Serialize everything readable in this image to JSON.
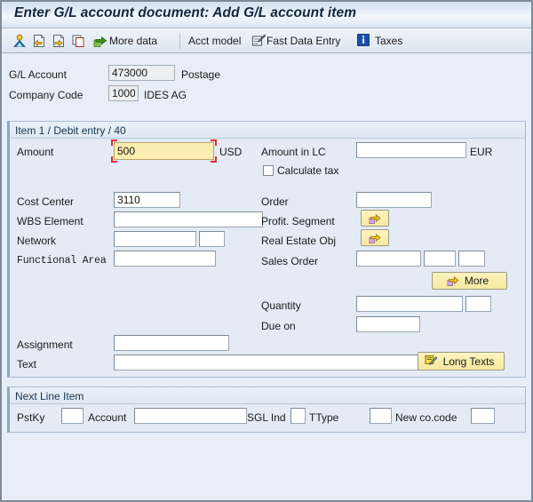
{
  "window": {
    "title": "Enter G/L account document: Add G/L account item"
  },
  "toolbar": {
    "items": [
      {
        "name": "person-icon",
        "label": "",
        "icon": "person-icon"
      },
      {
        "name": "prev-screen-icon",
        "label": "",
        "icon": "page-left-arrow-icon"
      },
      {
        "name": "next-screen-icon",
        "label": "",
        "icon": "page-right-arrow-icon"
      },
      {
        "name": "copy-icon",
        "label": "",
        "icon": "copy-icon"
      },
      {
        "name": "more-data-button",
        "label": "More data",
        "icon": "green-right-arrow-icon"
      },
      {
        "name": "acct-model-button",
        "label": "Acct model",
        "icon": "none"
      },
      {
        "name": "fast-data-entry-button",
        "label": "Fast Data Entry",
        "icon": "pencil-form-icon"
      },
      {
        "name": "taxes-button",
        "label": "Taxes",
        "icon": "info-icon"
      }
    ]
  },
  "header": {
    "gl_account": {
      "label": "G/L Account",
      "value": "473000",
      "text": "Postage"
    },
    "company_code": {
      "label": "Company Code",
      "value": "1000",
      "text": "IDES AG"
    }
  },
  "item_panel": {
    "title": "Item 1 / Debit entry / 40",
    "amount": {
      "label": "Amount",
      "value": "500",
      "currency": "USD"
    },
    "amount_lc": {
      "label": "Amount in LC",
      "value": "",
      "currency": "EUR"
    },
    "calculate_tax": {
      "label": "Calculate tax",
      "checked": false
    },
    "cost_center": {
      "label": "Cost Center",
      "value": "3110"
    },
    "wbs_element": {
      "label": "WBS Element",
      "value": ""
    },
    "network": {
      "label": "Network",
      "value": "",
      "value2": ""
    },
    "functional_area": {
      "label": "Functional Area",
      "value": ""
    },
    "order": {
      "label": "Order",
      "value": ""
    },
    "profit_segment": {
      "label": "Profit. Segment",
      "button": ""
    },
    "real_estate_obj": {
      "label": "Real Estate Obj",
      "button": ""
    },
    "sales_order": {
      "label": "Sales Order",
      "value": "",
      "value2": "",
      "value3": ""
    },
    "more_button": {
      "label": "More"
    },
    "quantity": {
      "label": "Quantity",
      "value": "",
      "unit": ""
    },
    "due_on": {
      "label": "Due on",
      "value": ""
    },
    "assignment": {
      "label": "Assignment",
      "value": ""
    },
    "text": {
      "label": "Text",
      "value": ""
    },
    "long_texts_button": {
      "label": "Long Texts"
    }
  },
  "next_line_item": {
    "title": "Next Line Item",
    "pstky": {
      "label": "PstKy",
      "value": ""
    },
    "account": {
      "label": "Account",
      "value": ""
    },
    "sgl_ind": {
      "label": "SGL Ind",
      "value": ""
    },
    "ttype": {
      "label": "TType",
      "value": ""
    },
    "new_cocode": {
      "label": "New co.code",
      "value": ""
    }
  },
  "colors": {
    "window_bg": "#e8eef7",
    "panel_bg": "#e4ebf5",
    "panel_border": "#a9bdd4",
    "accent_blue": "#8ba9c9",
    "focus_red": "#e03030",
    "focus_field_yellow": "#fcedb0",
    "button_yellow": "#f7e9a0",
    "title_text": "#12263c"
  }
}
